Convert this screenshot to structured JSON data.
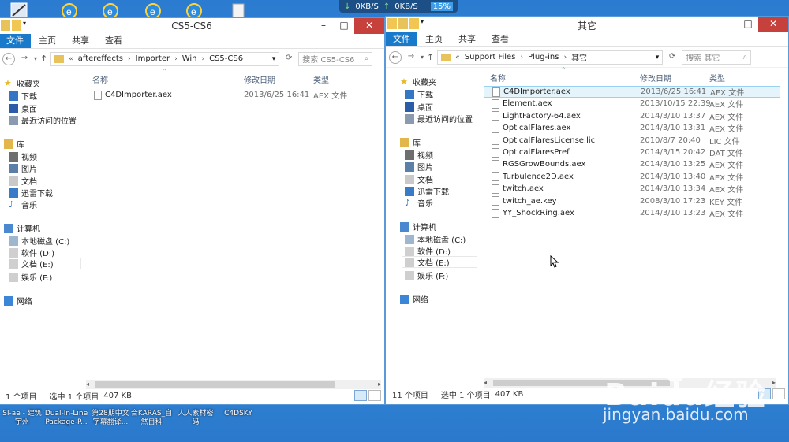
{
  "desktop": {
    "netmeter": {
      "down": "0KB/S",
      "up": "0KB/S",
      "percent": "15%"
    },
    "taskbar_items": [
      {
        "label": "Sl-ae - 建筑\n宇州"
      },
      {
        "label": "Dual-In-Line\nPackage-P..."
      },
      {
        "label": "第28期中文\n字幕翻译..."
      },
      {
        "label": "合KARAS_自\n然自科"
      },
      {
        "label": "人人素材密\n码"
      },
      {
        "label": "C4DSKY"
      }
    ],
    "watermark": {
      "brand": "Baidu经验",
      "url": "jingyan.baidu.com"
    }
  },
  "left_window": {
    "title": "CS5-CS6",
    "ribbon": {
      "file": "文件",
      "tabs": [
        "主页",
        "共享",
        "查看"
      ]
    },
    "address": {
      "prefix": "«",
      "segments": [
        "aftereffects",
        "Importer",
        "Win",
        "CS5-CS6"
      ]
    },
    "search_placeholder": "搜索 CS5-CS6",
    "nav": {
      "favorites": "收藏夹",
      "fav_items": [
        "下载",
        "桌面",
        "最近访问的位置"
      ],
      "library": "库",
      "lib_items": [
        "视频",
        "图片",
        "文档",
        "迅雷下载",
        "音乐"
      ],
      "computer": "计算机",
      "drives": [
        "本地磁盘 (C:)",
        "软件 (D:)",
        "文档 (E:)",
        "娱乐 (F:)"
      ],
      "network": "网络"
    },
    "columns": {
      "name": "名称",
      "date": "修改日期",
      "type": "类型"
    },
    "files": [
      {
        "name": "C4DImporter.aex",
        "date": "2013/6/25 16:41",
        "type": "AEX 文件"
      }
    ],
    "status": {
      "count": "1 个项目",
      "selected": "选中 1 个项目",
      "size": "407 KB"
    }
  },
  "right_window": {
    "title": "其它",
    "ribbon": {
      "file": "文件",
      "tabs": [
        "主页",
        "共享",
        "查看"
      ]
    },
    "address": {
      "prefix": "«",
      "segments": [
        "Support Files",
        "Plug-ins",
        "其它"
      ]
    },
    "search_placeholder": "搜索 其它",
    "nav": {
      "favorites": "收藏夹",
      "fav_items": [
        "下载",
        "桌面",
        "最近访问的位置"
      ],
      "library": "库",
      "lib_items": [
        "视频",
        "图片",
        "文档",
        "迅雷下载",
        "音乐"
      ],
      "computer": "计算机",
      "drives": [
        "本地磁盘 (C:)",
        "软件 (D:)",
        "文档 (E:)",
        "娱乐 (F:)"
      ],
      "network": "网络"
    },
    "columns": {
      "name": "名称",
      "date": "修改日期",
      "type": "类型"
    },
    "files": [
      {
        "name": "C4DImporter.aex",
        "date": "2013/6/25 16:41",
        "type": "AEX 文件"
      },
      {
        "name": "Element.aex",
        "date": "2013/10/15 22:39",
        "type": "AEX 文件"
      },
      {
        "name": "LightFactory-64.aex",
        "date": "2014/3/10 13:37",
        "type": "AEX 文件"
      },
      {
        "name": "OpticalFlares.aex",
        "date": "2014/3/10 13:31",
        "type": "AEX 文件"
      },
      {
        "name": "OpticalFlaresLicense.lic",
        "date": "2010/8/7 20:40",
        "type": "LIC 文件"
      },
      {
        "name": "OpticalFlaresPref",
        "date": "2014/3/15 20:42",
        "type": "DAT 文件"
      },
      {
        "name": "RGSGrowBounds.aex",
        "date": "2014/3/10 13:25",
        "type": "AEX 文件"
      },
      {
        "name": "Turbulence2D.aex",
        "date": "2014/3/10 13:40",
        "type": "AEX 文件"
      },
      {
        "name": "twitch.aex",
        "date": "2014/3/10 13:34",
        "type": "AEX 文件"
      },
      {
        "name": "twitch_ae.key",
        "date": "2008/3/10 17:23",
        "type": "KEY 文件"
      },
      {
        "name": "YY_ShockRing.aex",
        "date": "2014/3/10 13:23",
        "type": "AEX 文件"
      }
    ],
    "status": {
      "count": "11 个项目",
      "selected": "选中 1 个项目",
      "size": "407 KB"
    }
  }
}
